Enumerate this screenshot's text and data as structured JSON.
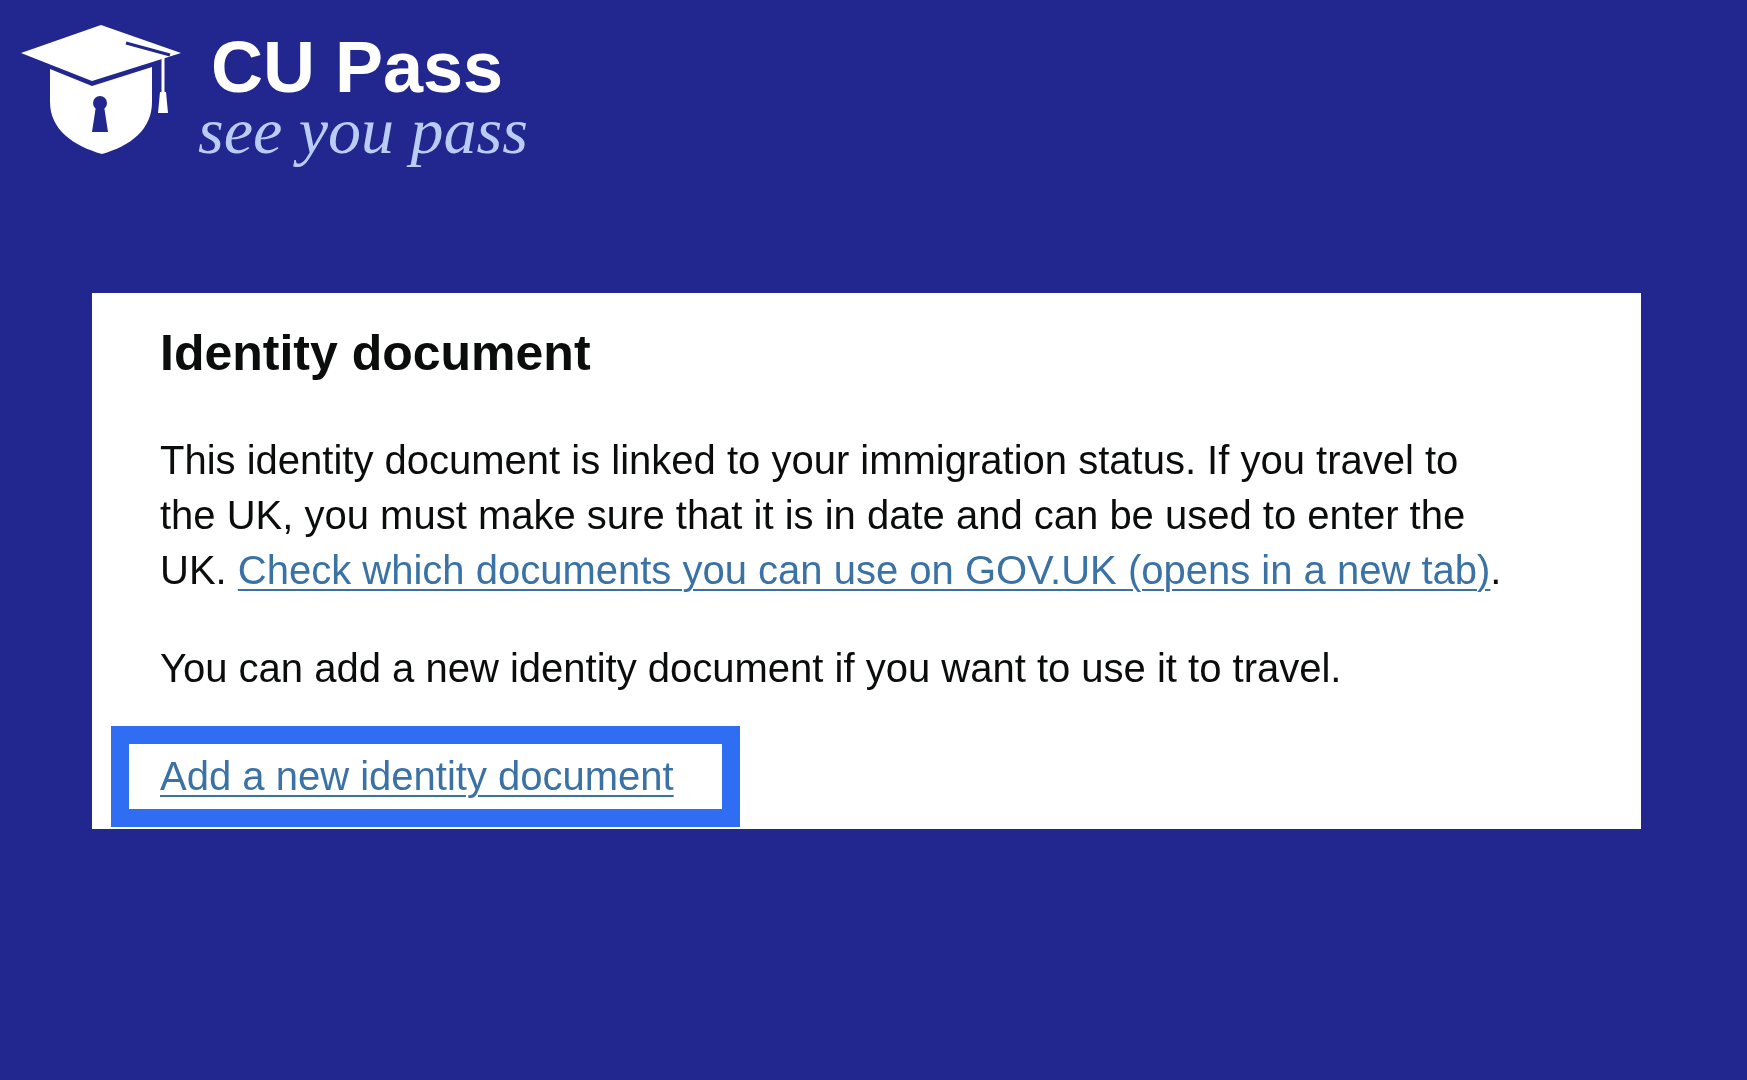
{
  "logo": {
    "name": "CU Pass",
    "tagline": "see you pass"
  },
  "card": {
    "title": "Identity document",
    "paragraphs": [
      {
        "text": "This identity document is linked to your immigration status. If you travel to the UK, you must make sure that it is in date and can be used to enter the UK.",
        "link": "Check which documents you can use on GOV.UK (opens in a new tab)",
        "after": "."
      },
      {
        "text": "You can add a new identity document if you want to use it to travel."
      }
    ],
    "action": {
      "label": "Add a new identity document",
      "highlighted": true
    }
  }
}
